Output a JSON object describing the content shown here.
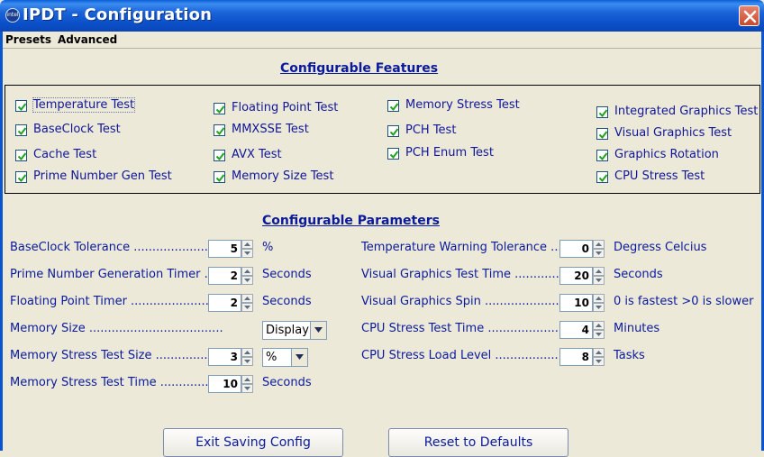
{
  "window": {
    "title": "IPDT - Configuration",
    "icon": "intel-icon"
  },
  "menu": [
    "Presets",
    "Advanced"
  ],
  "features": {
    "title": "Configurable Features",
    "items": [
      {
        "label": "Temperature Test",
        "checked": true
      },
      {
        "label": "BaseClock Test",
        "checked": true
      },
      {
        "label": "Cache Test",
        "checked": true
      },
      {
        "label": "Prime Number Gen Test",
        "checked": true
      },
      {
        "label": "Floating Point Test",
        "checked": true
      },
      {
        "label": "MMXSSE Test",
        "checked": true
      },
      {
        "label": "AVX Test",
        "checked": true
      },
      {
        "label": "Memory Size Test",
        "checked": true
      },
      {
        "label": "Memory Stress Test",
        "checked": true
      },
      {
        "label": "PCH Test",
        "checked": true
      },
      {
        "label": "PCH Enum Test",
        "checked": true
      },
      {
        "label": "Integrated Graphics Test",
        "checked": true
      },
      {
        "label": "Visual Graphics Test",
        "checked": true
      },
      {
        "label": "Graphics Rotation",
        "checked": true
      },
      {
        "label": "CPU Stress Test",
        "checked": true
      }
    ]
  },
  "parameters": {
    "title": "Configurable Parameters",
    "left": [
      {
        "label": "BaseClock Tolerance ......................",
        "value": "5",
        "unit": "%"
      },
      {
        "label": "Prime Number Generation Timer ....",
        "value": "2",
        "unit": "Seconds"
      },
      {
        "label": "Floating Point Timer ........................",
        "value": "2",
        "unit": "Seconds"
      },
      {
        "label": "Memory Size ....................................",
        "dropdown": "Display"
      },
      {
        "label": "Memory Stress Test Size ...............",
        "value": "3",
        "dropdown": "%"
      },
      {
        "label": "Memory Stress Test Time ..............",
        "value": "10",
        "unit": "Seconds"
      }
    ],
    "right": [
      {
        "label": "Temperature Warning Tolerance ....",
        "value": "0",
        "unit": "Degress Celcius"
      },
      {
        "label": "Visual Graphics Test Time ..............",
        "value": "20",
        "unit": "Seconds"
      },
      {
        "label": "Visual Graphics Spin .......................",
        "value": "10",
        "unit": "0 is fastest >0 is slower"
      },
      {
        "label": "CPU Stress Test Time ....................",
        "value": "4",
        "unit": "Minutes"
      },
      {
        "label": "CPU Stress Load Level ...................",
        "value": "8",
        "unit": "Tasks"
      }
    ]
  },
  "buttons": {
    "exit": "Exit Saving Config",
    "reset": "Reset to Defaults"
  },
  "colors": {
    "titlebar": "#0b4fc8",
    "label_text": "#0a1a9c",
    "background": "#ece9d8",
    "close": "#c94a2c"
  }
}
